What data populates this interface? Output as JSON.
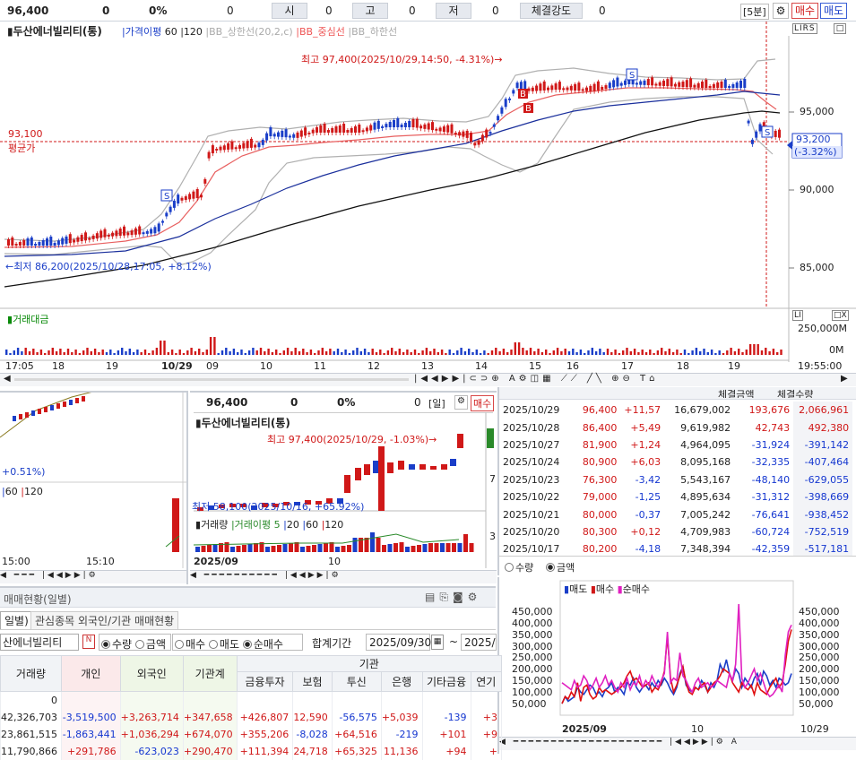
{
  "header": {
    "price": "96,400",
    "change": "0",
    "rate": "0%",
    "volume": "0",
    "open_label": "시",
    "open_val": "0",
    "high_label": "고",
    "high_val": "0",
    "low_label": "저",
    "low_val": "0",
    "strength_label": "체결강도",
    "strength_val": "0",
    "interval": "[5분]",
    "sell_btn": "매수",
    "buy_btn": "매도"
  },
  "main_chart": {
    "title": "두산에너빌리티(통)",
    "legend_ma": "가격이평",
    "legend_ma_values": [
      "60",
      "120"
    ],
    "legend_bb_upper": "BB_상한선(20,2,c)",
    "legend_bb_mid": "BB_중심선",
    "legend_bb_lower": "BB_하한선",
    "high_note": "최고 97,400(2025/10/29,14:50, -4.31%)→",
    "low_note": "←최저 86,200(2025/10/28,17:05, +8.12%)",
    "avg_price": "93,100",
    "avg_label": "평균가",
    "current_price": "93,200",
    "current_rate": "(-3.32%)",
    "y_ticks": [
      "95,000",
      "90,000",
      "85,000"
    ],
    "volume_title": "거래대금",
    "volume_ticks": [
      "250,000M",
      "0M"
    ],
    "x_ticks": [
      "17:05",
      "18",
      "19",
      "10/29",
      "09",
      "10",
      "11",
      "12",
      "13",
      "14",
      "15",
      "16",
      "17",
      "18",
      "19"
    ],
    "time": "19:55:00",
    "corner_icons": "LIRS"
  },
  "mid_chart": {
    "price": "96,400",
    "change": "0",
    "rate": "0%",
    "volume": "0",
    "period": "[일]",
    "sell_btn": "매수",
    "title": "두산에너빌리티(통)",
    "high_note": "최고 97,400(2025/10/29, -1.03%)→",
    "low_note": "최저 58,100(2025/10/16, +65.92%)",
    "volume_legend": "거래량",
    "volume_ma": "거래이평 5",
    "volume_ma_values": [
      "20",
      "60",
      "120"
    ],
    "x_left": "2025/09",
    "x_mid": "10",
    "side_ticks": [
      "7",
      "3"
    ]
  },
  "left_chart": {
    "rate": "+0.51%)",
    "legend": [
      "60",
      "120"
    ],
    "x_ticks": [
      "15:00",
      "15:10"
    ]
  },
  "daily_table": {
    "headers": [
      "체결금액",
      "체결수량"
    ],
    "rows": [
      [
        "2025/10/29",
        "96,400",
        "+11,57",
        "16,679,002",
        "193,676",
        "2,066,961"
      ],
      [
        "2025/10/28",
        "86,400",
        "+5,49",
        "9,619,982",
        "42,743",
        "492,380"
      ],
      [
        "2025/10/27",
        "81,900",
        "+1,24",
        "4,964,095",
        "-31,924",
        "-391,142"
      ],
      [
        "2025/10/24",
        "80,900",
        "+6,03",
        "8,095,168",
        "-32,335",
        "-407,464"
      ],
      [
        "2025/10/23",
        "76,300",
        "-3,42",
        "5,543,167",
        "-48,140",
        "-629,055"
      ],
      [
        "2025/10/22",
        "79,000",
        "-1,25",
        "4,895,634",
        "-31,312",
        "-398,669"
      ],
      [
        "2025/10/21",
        "80,000",
        "-0,37",
        "7,005,242",
        "-76,641",
        "-938,452"
      ],
      [
        "2025/10/20",
        "80,300",
        "+0,12",
        "4,709,983",
        "-60,724",
        "-752,519"
      ],
      [
        "2025/10/17",
        "80,200",
        "-4,18",
        "7,348,394",
        "-42,359",
        "-517,181"
      ]
    ],
    "radio_qty": "수량",
    "radio_amt": "금액"
  },
  "trade_chart": {
    "legend_sell": "매도",
    "legend_buy": "매수",
    "legend_net": "순매수",
    "y_ticks": [
      "450,000",
      "400,000",
      "350,000",
      "300,000",
      "250,000",
      "200,000",
      "150,000",
      "100,000",
      "50,000"
    ],
    "x_left": "2025/09",
    "x_mid": "10",
    "x_right": "10/29",
    "sell_values": [
      5,
      8,
      6,
      7,
      8,
      12,
      10,
      9,
      11,
      13,
      12,
      9,
      10,
      8,
      11,
      12,
      14,
      10,
      12,
      11,
      9,
      14,
      13,
      16,
      12,
      10,
      12,
      13,
      11,
      14,
      12,
      15,
      13,
      16,
      14,
      11,
      9,
      12,
      18,
      21,
      13,
      11,
      10,
      12,
      11,
      15,
      13,
      10,
      14,
      12,
      15,
      22,
      19,
      24,
      18,
      15,
      20,
      18,
      12,
      16,
      14,
      12,
      16,
      18,
      13,
      19,
      17,
      13,
      15,
      12,
      16,
      15,
      13,
      14,
      18
    ],
    "buy_values": [
      5,
      8,
      7,
      10,
      8,
      14,
      6,
      12,
      13,
      9,
      7,
      8,
      12,
      10,
      11,
      10,
      9,
      10,
      11,
      12,
      14,
      17,
      19,
      15,
      16,
      14,
      12,
      13,
      14,
      10,
      12,
      11,
      14,
      19,
      34,
      16,
      10,
      13,
      17,
      21,
      14,
      10,
      9,
      12,
      11,
      13,
      14,
      10,
      12,
      14,
      15,
      17,
      20,
      19,
      18,
      14,
      12,
      10,
      14,
      12,
      11,
      13,
      9,
      14,
      11,
      10,
      9,
      12,
      14,
      16,
      12,
      14,
      22,
      32,
      37
    ],
    "net_values": [
      14,
      13,
      12,
      11,
      15,
      12,
      13,
      17,
      15,
      11,
      13,
      16,
      12,
      14,
      17,
      13,
      15,
      12,
      10,
      14,
      12,
      16,
      11,
      14,
      13,
      17,
      12,
      15,
      13,
      17,
      14,
      12,
      15,
      18,
      36,
      14,
      16,
      15,
      27,
      17,
      15,
      12,
      10,
      14,
      16,
      12,
      13,
      14,
      12,
      13,
      15,
      14,
      13,
      12,
      18,
      15,
      22,
      48,
      16,
      12,
      14,
      17,
      20,
      15,
      18,
      14,
      10,
      8,
      9,
      11,
      13,
      10,
      26,
      36,
      39
    ]
  },
  "bottom_panel": {
    "title": "매매현황(일별)",
    "tab_active": "일별)",
    "tab_other": "관심종목 외국인/기관 매매현황",
    "stock": "산에너빌리티",
    "radios": [
      "수량",
      "금액",
      "매수",
      "매도",
      "순매수"
    ],
    "period_label": "합계기간",
    "date_from": "2025/09/30",
    "date_to": "2025/",
    "group_label": "기관",
    "columns": [
      "거래량",
      "개인",
      "외국인",
      "기관계",
      "금융투자",
      "보험",
      "투신",
      "은행",
      "기타금융",
      "연기"
    ],
    "rows": [
      [
        "0",
        "",
        "",
        "",
        "",
        "",
        "",
        "",
        "",
        ""
      ],
      [
        "42,326,703",
        "-3,519,500",
        "+3,263,714",
        "+347,658",
        "+426,807",
        "12,590",
        "-56,575",
        "+5,039",
        "-139",
        "+3"
      ],
      [
        "23,861,515",
        "-1,863,441",
        "+1,036,294",
        "+674,070",
        "+355,206",
        "-8,028",
        "+64,516",
        "-219",
        "+101",
        "+9"
      ],
      [
        "11,790,866",
        "+291,786",
        "-623,023",
        "+290,470",
        "+111,394",
        "24,718",
        "+65,325",
        "11,136",
        "+94",
        "+"
      ]
    ]
  }
}
